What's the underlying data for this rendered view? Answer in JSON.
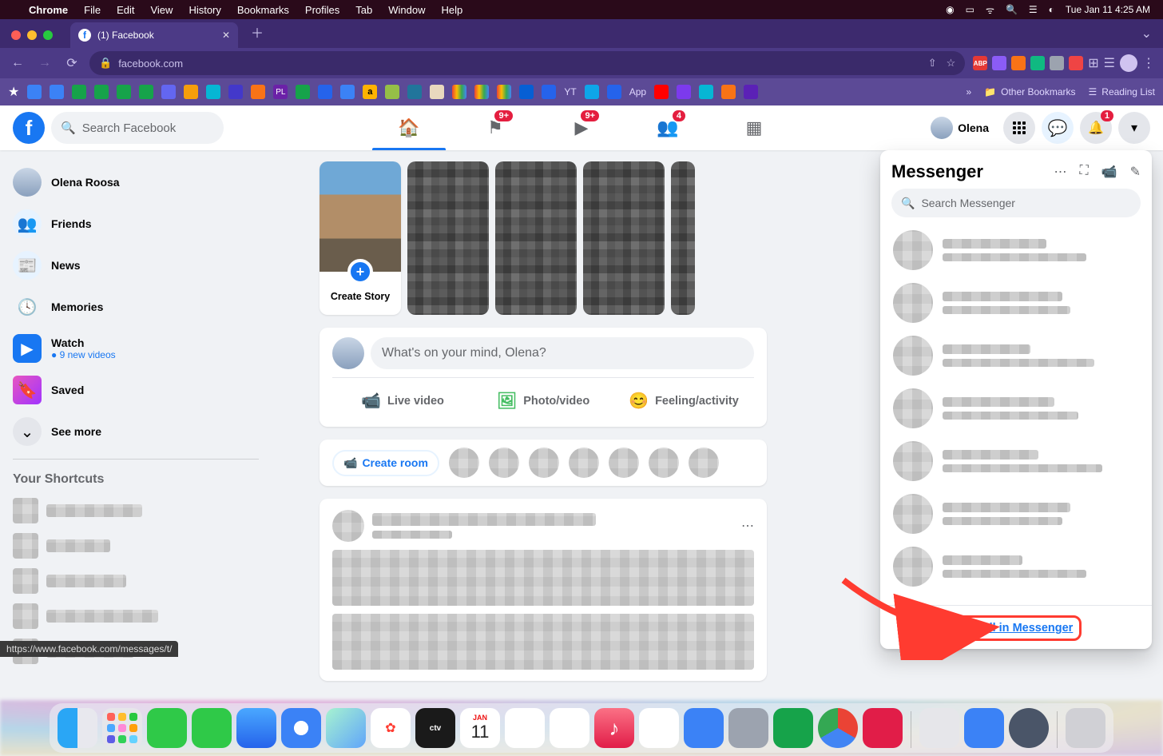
{
  "macos": {
    "app": "Chrome",
    "menu": [
      "File",
      "Edit",
      "View",
      "History",
      "Bookmarks",
      "Profiles",
      "Tab",
      "Window",
      "Help"
    ],
    "clock": "Tue Jan 11  4:25 AM"
  },
  "chrome": {
    "tab_title": "(1) Facebook",
    "url": "facebook.com",
    "other_bookmarks": "Other Bookmarks",
    "reading_list": "Reading List",
    "bm_app": "App",
    "bm_yt": "YT",
    "ext_abp": "ABP",
    "status_url": "https://www.facebook.com/messages/t/"
  },
  "fb": {
    "search_placeholder": "Search Facebook",
    "profile_name": "Olena",
    "nav_badges": {
      "pages": "9+",
      "watch": "9+",
      "groups": "4"
    },
    "notif_badge": "1",
    "left": {
      "profile": "Olena Roosa",
      "friends": "Friends",
      "news": "News",
      "memories": "Memories",
      "watch": "Watch",
      "watch_sub": "● 9 new videos",
      "saved": "Saved",
      "see_more": "See more",
      "shortcuts_heading": "Your Shortcuts"
    },
    "feed": {
      "create_story": "Create Story",
      "composer_placeholder": "What's on your mind, Olena?",
      "live": "Live video",
      "photo": "Photo/video",
      "feeling": "Feeling/activity",
      "create_room": "Create room"
    },
    "messenger": {
      "title": "Messenger",
      "search_placeholder": "Search Messenger",
      "see_all": "See all in Messenger"
    }
  },
  "dock": {
    "cal_month": "JAN",
    "cal_day": "11",
    "tv": "ctv"
  }
}
